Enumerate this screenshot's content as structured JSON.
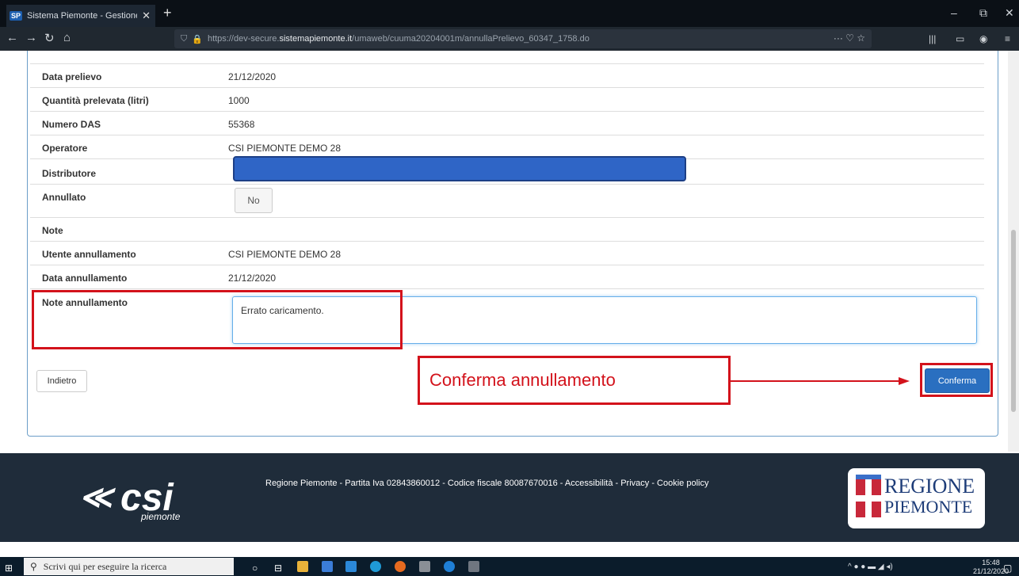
{
  "browser": {
    "tab_title": "Sistema Piemonte - Gestione a",
    "tab_badge": "SP",
    "url_prefix": "https://dev-secure.",
    "url_host": "sistemapiemonte.it",
    "url_path": "/umaweb/cuuma20204001m/annullaPrelievo_60347_1758.do"
  },
  "form": {
    "rows": [
      {
        "label": "Data prelievo",
        "value": "21/12/2020"
      },
      {
        "label": "Quantità prelevata (litri)",
        "value": "1000"
      },
      {
        "label": "Numero DAS",
        "value": "55368"
      },
      {
        "label": "Operatore",
        "value": "CSI PIEMONTE DEMO 28"
      },
      {
        "label": "Distributore",
        "value": ""
      },
      {
        "label": "Annullato",
        "value": "No"
      },
      {
        "label": "Note",
        "value": ""
      },
      {
        "label": "Utente annullamento",
        "value": "CSI PIEMONTE DEMO 28"
      },
      {
        "label": "Data annullamento",
        "value": "21/12/2020"
      },
      {
        "label": "Note annullamento",
        "value": "Errato caricamento."
      }
    ],
    "back_label": "Indietro",
    "confirm_label": "Conferma"
  },
  "annotation": {
    "callout_text": "Conferma annullamento",
    "highlight_color": "#d3121b"
  },
  "footer": {
    "links_text": "Regione Piemonte - Partita Iva 02843860012 - Codice fiscale 80087670016 - Accessibilità - Privacy - Cookie policy",
    "csi_word": "csi",
    "csi_sub": "piemonte",
    "regione_line1": "REGIONE",
    "regione_line2": "PIEMONTE"
  },
  "taskbar": {
    "search_placeholder": "Scrivi qui per eseguire la ricerca",
    "time": "15:48",
    "date": "21/12/2020"
  }
}
